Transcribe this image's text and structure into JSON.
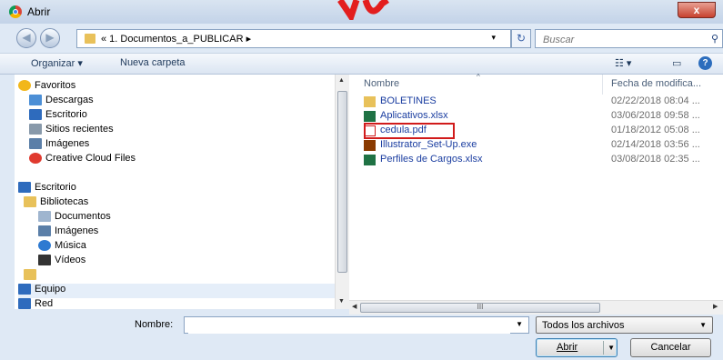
{
  "window": {
    "title": "Abrir",
    "close_label": "x"
  },
  "nav": {
    "back_label": "◀",
    "forward_label": "▶",
    "breadcrumb": "« 1. Documentos_a_PUBLICAR ▸",
    "dropdown": "▾",
    "refresh_label": "↻",
    "search_placeholder": "Buscar",
    "search_glyph": "⚲"
  },
  "toolbar": {
    "organize_label": "Organizar ▾",
    "new_folder_label": "Nueva carpeta",
    "view_glyph": "☷ ▾",
    "pane_glyph": "▭",
    "help_label": "?"
  },
  "sidebar": {
    "items": [
      {
        "label": "Favoritos",
        "icon": "star-icon",
        "color": "#f2b71a"
      },
      {
        "label": "Descargas",
        "icon": "downloads-icon",
        "color": "#4c8fd6"
      },
      {
        "label": "Escritorio",
        "icon": "desktop-icon",
        "color": "#2e6bbd"
      },
      {
        "label": "Sitios recientes",
        "icon": "recent-icon",
        "color": "#8899aa"
      },
      {
        "label": "Imágenes",
        "icon": "images-icon",
        "color": "#5b7fa8"
      },
      {
        "label": "Creative Cloud Files",
        "icon": "creative-cloud-icon",
        "color": "#e03a2f"
      },
      {
        "label": "Escritorio",
        "icon": "desktop-icon",
        "color": "#2e6bbd"
      },
      {
        "label": "Bibliotecas",
        "icon": "libraries-icon",
        "color": "#e8c15a"
      },
      {
        "label": "Documentos",
        "icon": "documents-icon",
        "color": "#9fb5cf"
      },
      {
        "label": "Imágenes",
        "icon": "images-icon",
        "color": "#5b7fa8"
      },
      {
        "label": "Música",
        "icon": "music-icon",
        "color": "#2e7ad1"
      },
      {
        "label": "Vídeos",
        "icon": "videos-icon",
        "color": "#333333"
      },
      {
        "label": "",
        "icon": "user-folder-icon",
        "color": "#e8c15a"
      },
      {
        "label": "Equipo",
        "icon": "computer-icon",
        "color": "#2e6bbd"
      },
      {
        "label": "Red",
        "icon": "network-icon",
        "color": "#2e6bbd"
      }
    ]
  },
  "files": {
    "columns": {
      "name": "Nombre",
      "date": "Fecha de modifica..."
    },
    "rows": [
      {
        "name": "BOLETINES",
        "date": "02/22/2018 08:04 ...",
        "icon": "folder-icon",
        "color": "#e8c15a"
      },
      {
        "name": "Aplicativos.xlsx",
        "date": "03/06/2018 09:58 ...",
        "icon": "excel-icon",
        "color": "#1f7244"
      },
      {
        "name": "cedula.pdf",
        "date": "01/18/2012 05:08 ...",
        "icon": "pdf-icon",
        "color": "#d11b1b"
      },
      {
        "name": "Illustrator_Set-Up.exe",
        "date": "02/14/2018 03:56 ...",
        "icon": "illustrator-icon",
        "color": "#8a3a00"
      },
      {
        "name": "Perfiles de Cargos.xlsx",
        "date": "03/08/2018 02:35 ...",
        "icon": "excel-icon",
        "color": "#1f7244"
      }
    ]
  },
  "scrollbar": {
    "grip": "III"
  },
  "bottom": {
    "name_label": "Nombre:",
    "name_value": "",
    "filter_value": "Todos los archivos",
    "open_label": "Abrir",
    "cancel_label": "Cancelar"
  },
  "colors": {
    "highlight": "#d11b1b",
    "accent": "#1a3da0"
  }
}
